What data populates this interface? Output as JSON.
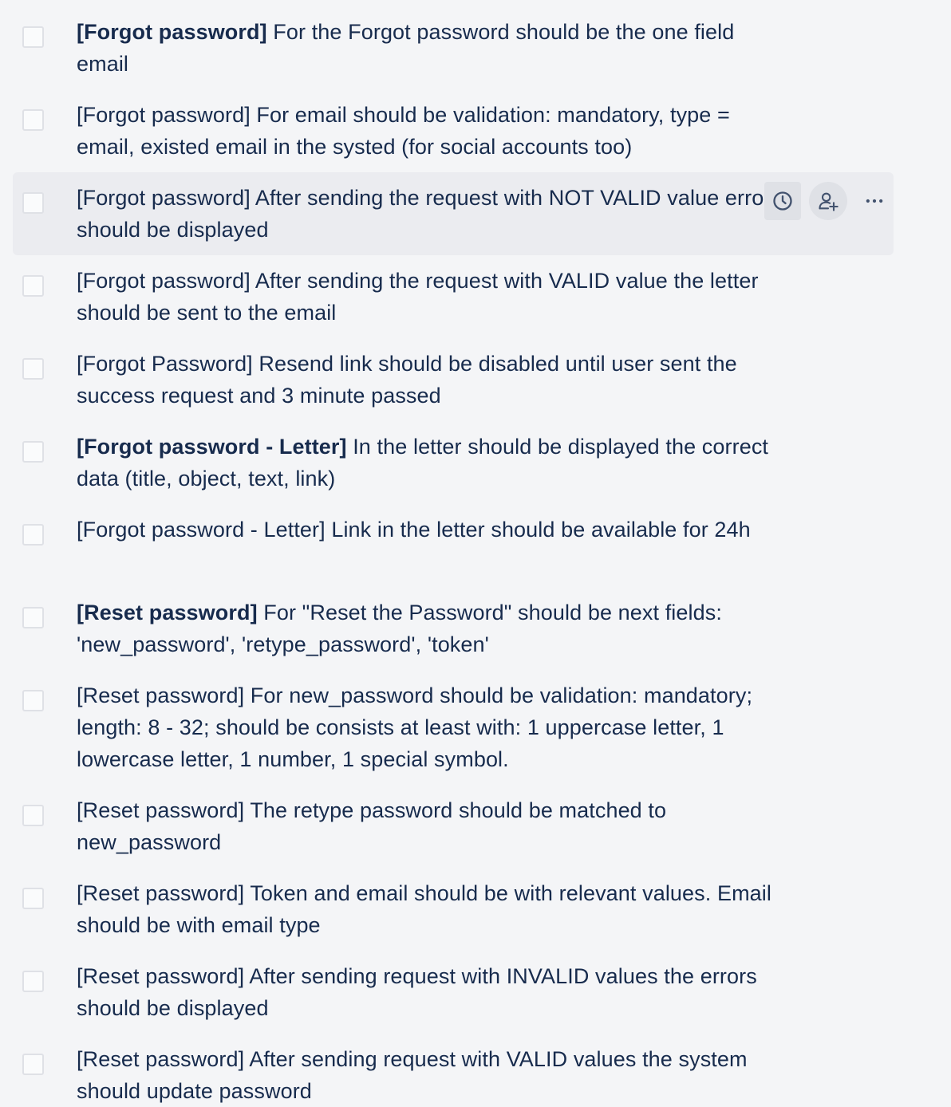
{
  "checklist": {
    "items": [
      {
        "tag": "[Forgot password]",
        "tag_bold": true,
        "text": " For the Forgot password should be the one field email"
      },
      {
        "tag": "[Forgot password]",
        "tag_bold": false,
        "text": " For email should be validation: mandatory, type = email, existed email in the systed (for social accounts too)"
      },
      {
        "tag": "[Forgot password]",
        "tag_bold": false,
        "text": " After sending the request with NOT VALID value error should be displayed"
      },
      {
        "tag": "[Forgot password]",
        "tag_bold": false,
        "text": " After sending the request with VALID value the letter should be sent to the email"
      },
      {
        "tag": "[Forgot Password]",
        "tag_bold": false,
        "text": " Resend link should be disabled until user sent the success request and 3 minute passed"
      },
      {
        "tag": "[Forgot password - Letter]",
        "tag_bold": true,
        "text": " In the letter should be displayed the correct data (title, object, text, link)"
      },
      {
        "tag": "[Forgot password - Letter]",
        "tag_bold": false,
        "text": " Link in the letter should be available for 24h"
      },
      {
        "tag": "[Reset password]",
        "tag_bold": true,
        "text": " For \"Reset the Password\" should be next fields: 'new_password', 'retype_password', 'token'"
      },
      {
        "tag": "[Reset password]",
        "tag_bold": false,
        "text": " For new_password should be validation: mandatory; length: 8 - 32; should be consists at least with: 1 uppercase letter, 1 lowercase letter, 1 number, 1 special symbol."
      },
      {
        "tag": "[Reset password]",
        "tag_bold": false,
        "text": " The retype password should be matched to new_password"
      },
      {
        "tag": "[Reset password]",
        "tag_bold": false,
        "text": " Token and email should be with relevant values. Email should be with email type"
      },
      {
        "tag": "[Reset password]",
        "tag_bold": false,
        "text": " After sending request with INVALID values the errors should be displayed"
      },
      {
        "tag": "[Reset password]",
        "tag_bold": false,
        "text": " After sending request with VALID values the system should update password"
      }
    ],
    "hover_actions": {
      "due_date_icon": "clock-icon",
      "assign_icon": "add-user-icon",
      "more_icon": "more-horizontal-icon"
    }
  }
}
